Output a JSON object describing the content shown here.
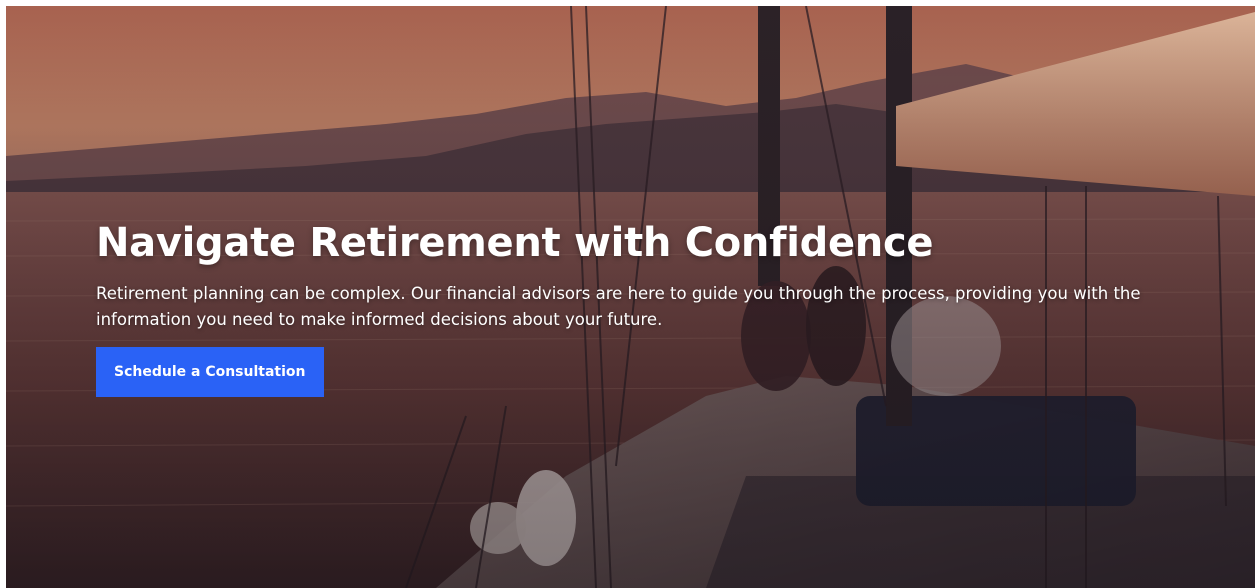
{
  "hero": {
    "title": "Navigate Retirement with Confidence",
    "description": "Retirement planning can be complex. Our financial advisors are here to guide you through the process, providing you with the information you need to make informed decisions about your future.",
    "cta_label": "Schedule a Consultation"
  },
  "colors": {
    "cta_background": "#2a62f6",
    "text": "#ffffff",
    "sky_top": "#c77a5e",
    "sea": "#6b3f3a"
  }
}
